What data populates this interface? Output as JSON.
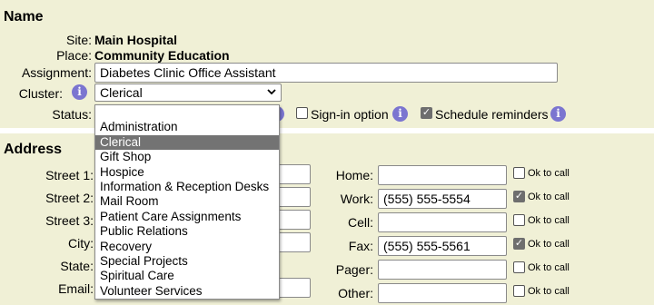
{
  "name_section": {
    "title": "Name",
    "site_label": "Site:",
    "site_value": "Main Hospital",
    "place_label": "Place:",
    "place_value": "Community Education",
    "assignment_label": "Assignment:",
    "assignment_value": "Diabetes Clinic Office Assistant",
    "cluster_label": "Cluster:",
    "cluster_value": "Clerical",
    "status_label": "Status:",
    "signin_label": "Sign-in option",
    "schedule_label": "Schedule reminders",
    "signin_checked": false,
    "schedule_checked": true
  },
  "cluster_options": [
    "",
    "Administration",
    "Clerical",
    "Gift Shop",
    "Hospice",
    "Information & Reception Desks",
    "Mail Room",
    "Patient Care Assignments",
    "Public Relations",
    "Recovery",
    "Special Projects",
    "Spiritual Care",
    "Volunteer Services"
  ],
  "address_section": {
    "title": "Address",
    "street1_label": "Street 1:",
    "street2_label": "Street 2:",
    "street3_label": "Street 3:",
    "city_label": "City:",
    "state_label": "State:",
    "email_label": "Email:"
  },
  "phones": {
    "ok_label": "Ok to call",
    "home_label": "Home:",
    "home_value": "",
    "home_ok": false,
    "work_label": "Work:",
    "work_value": "(555) 555-5554",
    "work_ok": true,
    "cell_label": "Cell:",
    "cell_value": "",
    "cell_ok": false,
    "fax_label": "Fax:",
    "fax_value": "(555) 555-5561",
    "fax_ok": true,
    "pager_label": "Pager:",
    "pager_value": "",
    "pager_ok": false,
    "other_label": "Other:",
    "other_value": "",
    "other_ok": false
  },
  "icons": {
    "info": "info-icon",
    "dropdown": "chevron-down-icon",
    "check": "checkmark-icon"
  },
  "colors": {
    "panel_bg": "#f0f0d6",
    "info_icon": "#7b75d0",
    "selected_option": "#737373"
  }
}
